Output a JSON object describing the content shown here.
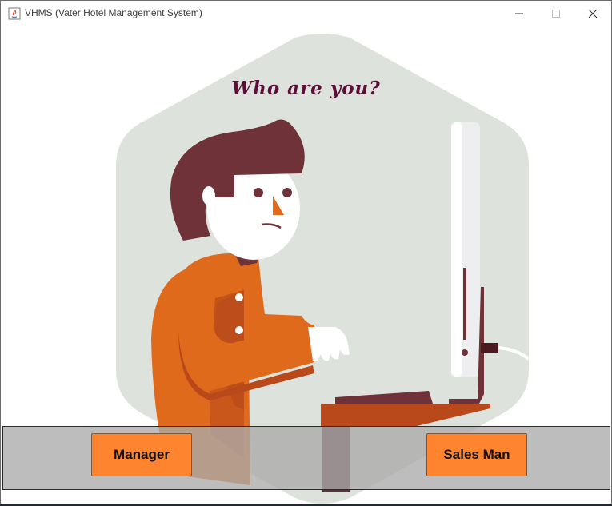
{
  "window": {
    "title": "VHMS (Vater Hotel Management System)",
    "icon": "java-cup-icon",
    "controls": [
      "minimize-icon",
      "maximize-icon",
      "close-icon"
    ]
  },
  "main": {
    "heading": "Who are you?",
    "illustration": "person-at-computer-illustration"
  },
  "buttons": {
    "manager_label": "Manager",
    "sales_label": "Sales Man"
  },
  "colors": {
    "button_bg": "#ff8430",
    "heading": "#5b0f38",
    "hexagon_bg": "#dde3dc",
    "shirt": "#e06a1b",
    "hair": "#6e3238"
  }
}
